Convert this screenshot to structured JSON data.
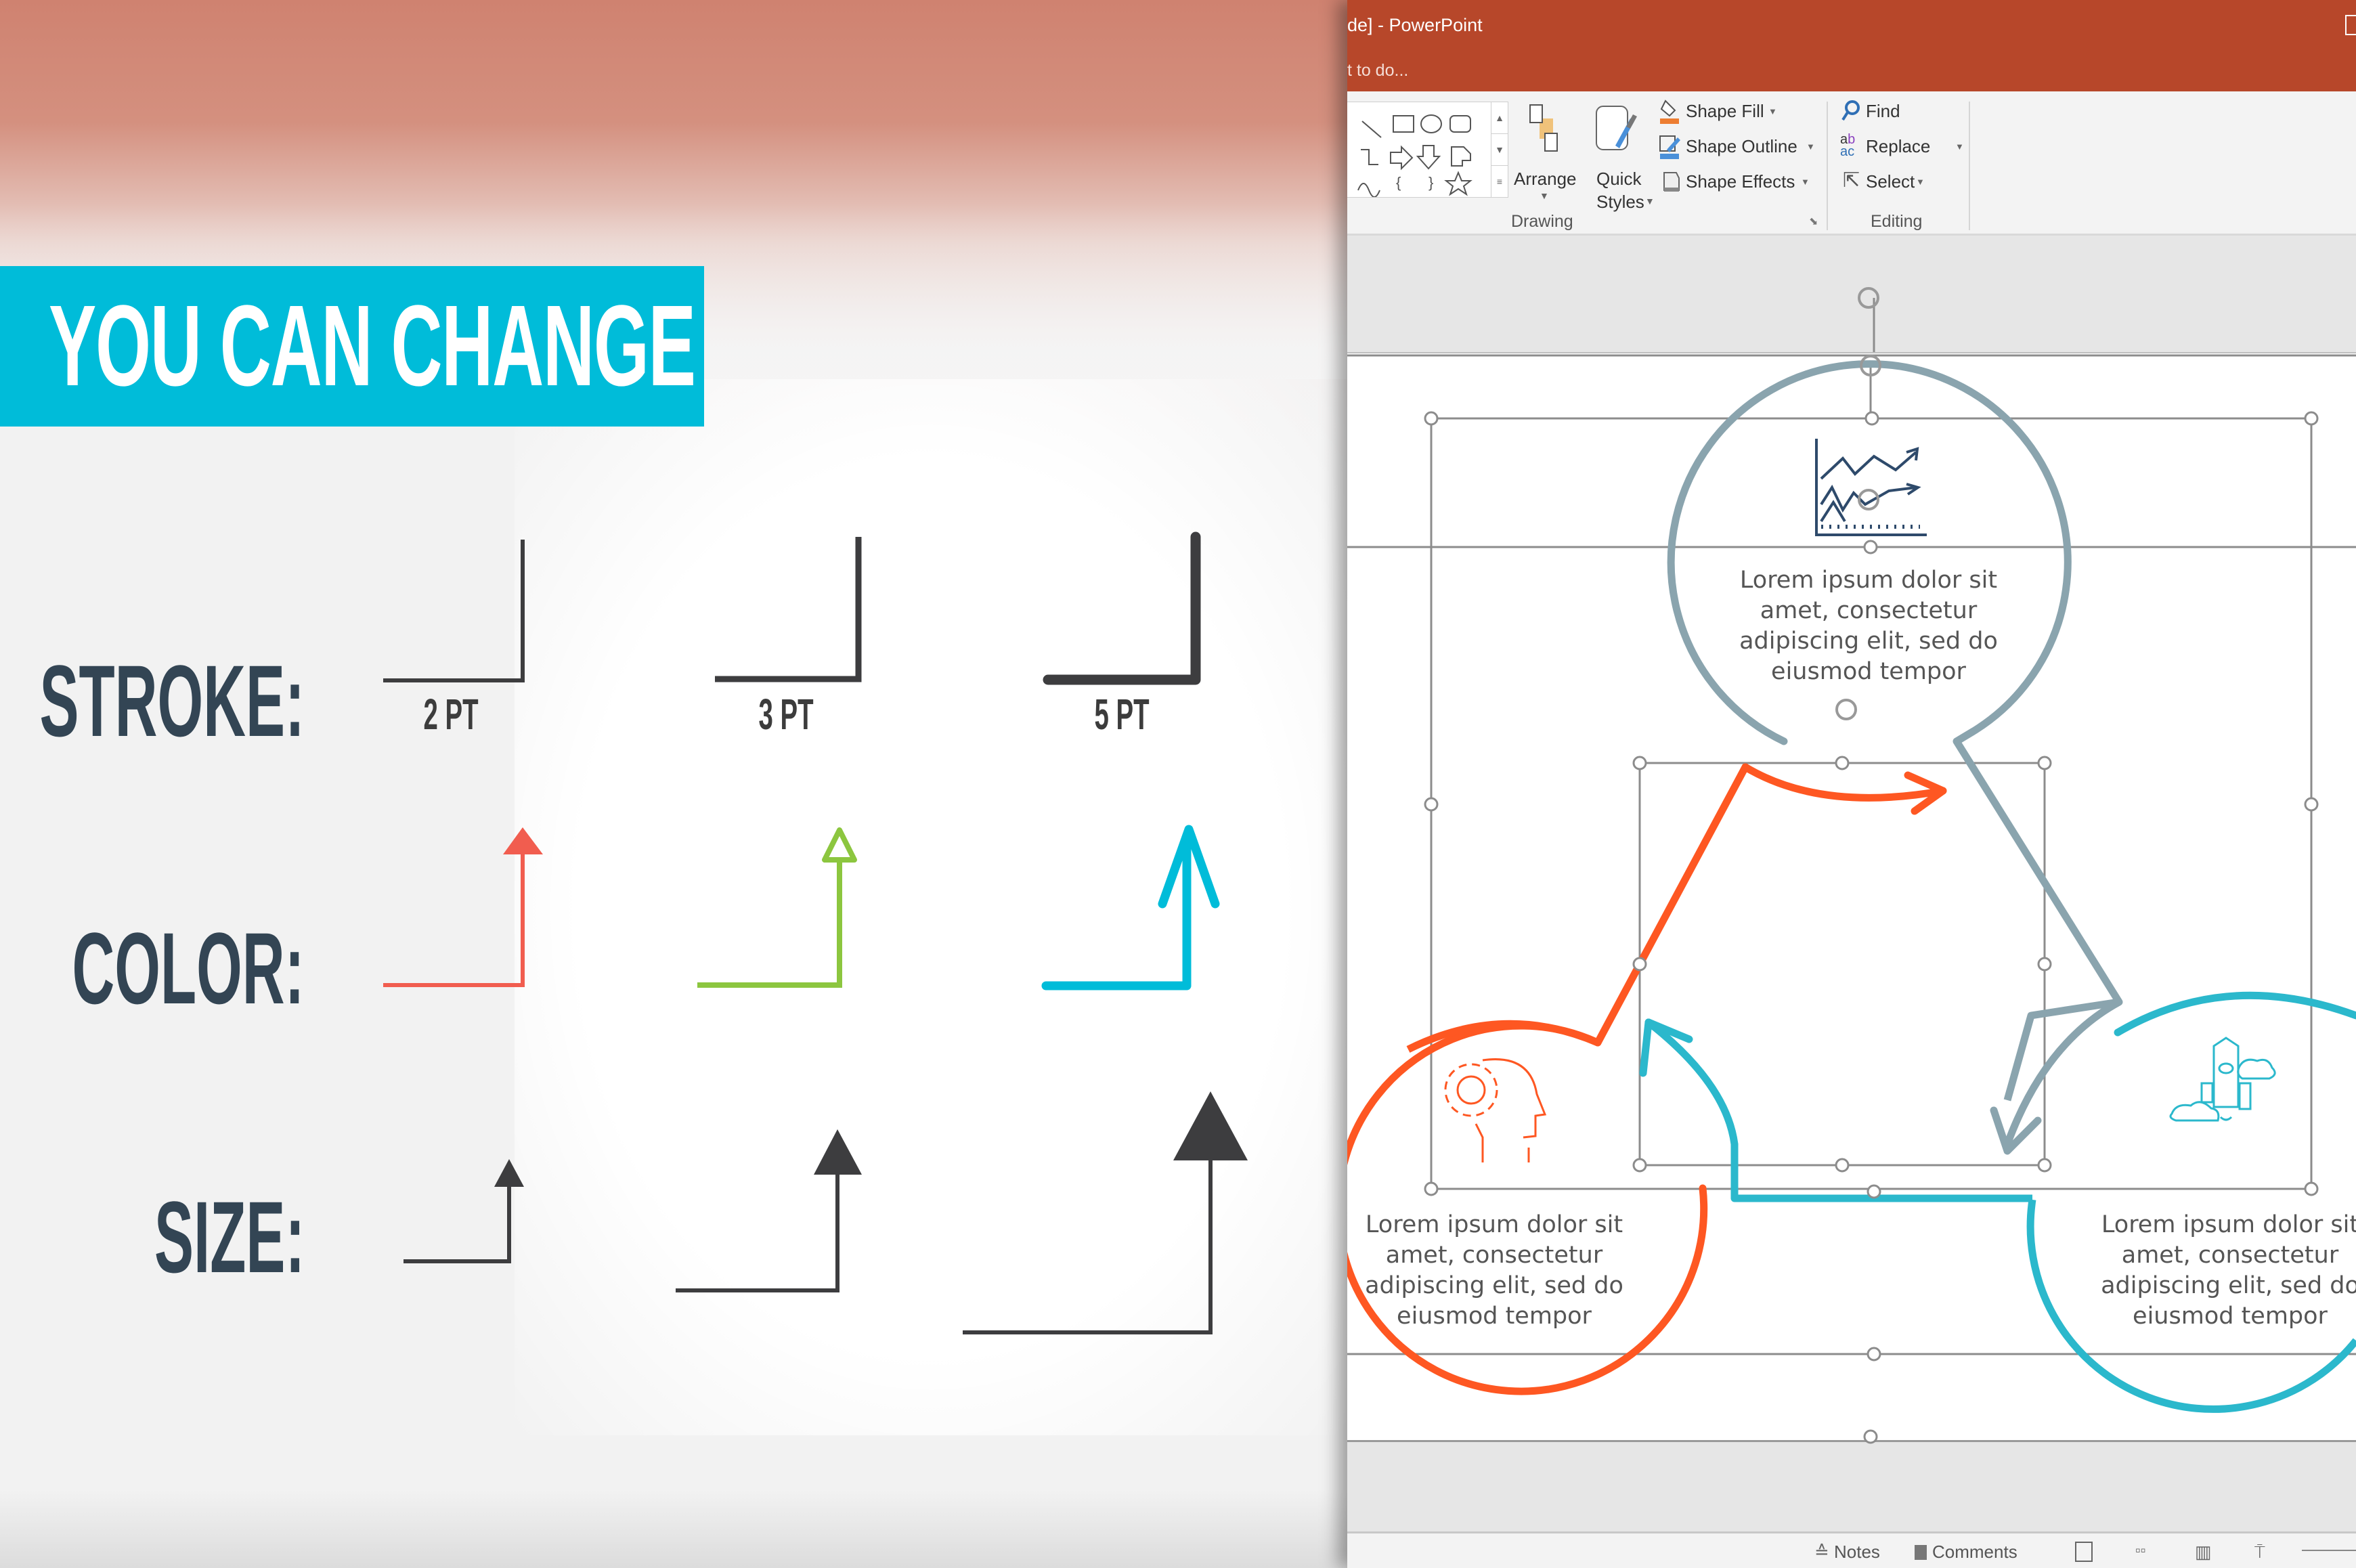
{
  "left_panel": {
    "banner_title": "YOU CAN CHANGE",
    "rows": [
      {
        "label": "STROKE:",
        "items": [
          {
            "caption": "2 PT",
            "stroke_pt": 2,
            "color": "#3d3d3f"
          },
          {
            "caption": "3 PT",
            "stroke_pt": 3,
            "color": "#3d3d3f"
          },
          {
            "caption": "5 PT",
            "stroke_pt": 5,
            "color": "#3d3d3f"
          }
        ]
      },
      {
        "label": "COLOR:",
        "items": [
          {
            "color": "#f15d4f",
            "arrowhead": "filled-triangle"
          },
          {
            "color": "#8cc63f",
            "arrowhead": "open-triangle"
          },
          {
            "color": "#00bcd9",
            "arrowhead": "open-chevron"
          }
        ]
      },
      {
        "label": "SIZE:",
        "items": [
          {
            "size": "small",
            "color": "#3d3d3f"
          },
          {
            "size": "medium",
            "color": "#3d3d3f"
          },
          {
            "size": "large",
            "color": "#3d3d3f"
          }
        ]
      }
    ],
    "colors": {
      "banner": "#00bcd9",
      "label_text": "#334554"
    }
  },
  "powerpoint": {
    "title": "de] - PowerPoint",
    "tell_me": "t to do...",
    "colors": {
      "titlebar": "#b7472a",
      "ribbon": "#f3f3f3",
      "canvas": "#e6e6e6"
    },
    "ribbon": {
      "drawing": {
        "arrange_label": "Arrange",
        "quick_styles_label_1": "Quick",
        "quick_styles_label_2": "Styles",
        "shape_fill": "Shape Fill",
        "shape_outline": "Shape Outline",
        "shape_effects": "Shape Effects",
        "group_label": "Drawing"
      },
      "editing": {
        "find": "Find",
        "replace": "Replace",
        "select": "Select",
        "group_label": "Editing"
      }
    },
    "slide": {
      "nodes": [
        {
          "text_lines": [
            "Lorem ipsum dolor sit",
            "amet, consectetur",
            "adipiscing elit, sed do",
            "eiusmod tempor"
          ],
          "color": "#8aa4ae",
          "icon": "growth-chart-icon"
        },
        {
          "text_lines": [
            "Lorem ipsum dolor sit",
            "amet, consectetur",
            "adipiscing elit, sed do",
            "eiusmod tempor"
          ],
          "color": "#fe5722",
          "icon": "head-gear-icon"
        },
        {
          "text_lines": [
            "Lorem ipsum dolor sit",
            "amet, consectetur",
            "adipiscing elit, sed do",
            "eiusmod tempor"
          ],
          "color": "#2bb8cc",
          "icon": "rocket-clouds-icon"
        }
      ]
    },
    "statusbar": {
      "notes": "Notes",
      "comments": "Comments"
    }
  }
}
